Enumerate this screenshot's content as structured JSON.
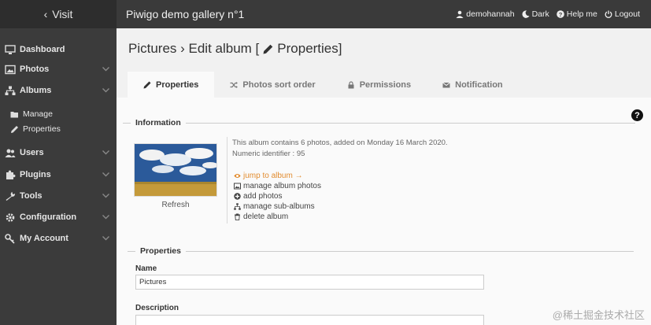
{
  "topbar": {
    "visit_label": "Visit",
    "gallery_title": "Piwigo demo gallery n°1",
    "links": [
      {
        "label": "demohannah",
        "icon": "user-icon"
      },
      {
        "label": "Dark",
        "icon": "moon-icon"
      },
      {
        "label": "Help me",
        "icon": "question-icon"
      },
      {
        "label": "Logout",
        "icon": "power-icon"
      }
    ]
  },
  "sidebar": {
    "items": [
      {
        "label": "Dashboard",
        "icon": "dashboard-icon"
      },
      {
        "label": "Photos",
        "icon": "photo-icon"
      },
      {
        "label": "Albums",
        "icon": "sitemap-icon"
      },
      {
        "label": "Users",
        "icon": "users-icon"
      },
      {
        "label": "Plugins",
        "icon": "puzzle-icon"
      },
      {
        "label": "Tools",
        "icon": "wrench-icon"
      },
      {
        "label": "Configuration",
        "icon": "gears-icon"
      },
      {
        "label": "My Account",
        "icon": "key-icon"
      }
    ],
    "subitems": [
      {
        "label": "Manage",
        "icon": "folder-open-icon"
      },
      {
        "label": "Properties",
        "icon": "pencil-icon"
      }
    ]
  },
  "page": {
    "title_prefix": "Pictures › Edit album [",
    "title_suffix": "Properties]"
  },
  "tabs": [
    {
      "label": "Properties",
      "icon": "pencil-icon",
      "active": true
    },
    {
      "label": "Photos sort order",
      "icon": "shuffle-icon",
      "active": false
    },
    {
      "label": "Permissions",
      "icon": "lock-icon",
      "active": false
    },
    {
      "label": "Notification",
      "icon": "envelope-icon",
      "active": false
    }
  ],
  "information": {
    "section_label": "Information",
    "info_line1": "This album contains 6 photos, added on Monday 16 March 2020.",
    "info_line2": "Numeric identifier : 95",
    "refresh_label": "Refresh",
    "actions": [
      {
        "label": "jump to album →",
        "icon": "eye-icon"
      },
      {
        "label": "manage album photos",
        "icon": "image-icon"
      },
      {
        "label": "add photos",
        "icon": "plus-circle-icon"
      },
      {
        "label": "manage sub-albums",
        "icon": "sitemap-icon"
      },
      {
        "label": "delete album",
        "icon": "trash-icon"
      }
    ]
  },
  "properties": {
    "section_label": "Properties",
    "name_label": "Name",
    "name_value": "Pictures",
    "description_label": "Description"
  },
  "help_glyph": "?",
  "watermark": "@稀土掘金技术社区",
  "colors": {
    "topbar": "#3a3a3a",
    "sidebar": "#3b3b3b",
    "accent_link": "#e28c2f"
  }
}
